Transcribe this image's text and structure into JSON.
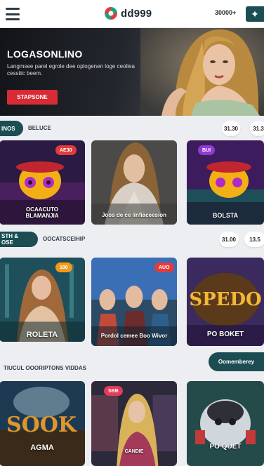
{
  "header": {
    "brand": "dd999",
    "balance": "30000+",
    "action_icon": "plus-sparkle-icon"
  },
  "hero": {
    "title": "LOGASONLINO",
    "subtitle": "Langmsee parel egrole dee oplogenen loge ceoliea cessiiic beem.",
    "cta": "STAPSONE"
  },
  "rows": [
    {
      "pill": "INOS",
      "label": "BELUCE",
      "chips": [
        "31.30",
        "31.3"
      ]
    },
    {
      "pill": "STH & OSE",
      "label": "OOCATSCEIHIP",
      "chips": [
        "31.00",
        "13.5"
      ]
    }
  ],
  "games_row1": [
    {
      "badge": "AE30",
      "title": "OCAACUTO\nBLAMANJIA"
    },
    {
      "badge": "",
      "title": "Joos de ce linfiaceesion"
    },
    {
      "badge": "BUI",
      "title": "BOLSTA"
    }
  ],
  "games_row2": [
    {
      "badge": "100",
      "title": "ROLETA"
    },
    {
      "badge": "AUO",
      "title": "Pordol cemee Boo Wivor"
    },
    {
      "badge": "",
      "title": "PO BOKET"
    }
  ],
  "section": {
    "title": "TIUCUL OOORIPTONS VIDDAS",
    "cta": "Oomemberey"
  },
  "games_row3": [
    {
      "badge": "",
      "title": "AGMA"
    },
    {
      "badge": "SBB",
      "title": "CANDIE"
    },
    {
      "badge": "",
      "title": "PO QUET"
    }
  ],
  "colors": {
    "accent": "#1b4d52",
    "cta_red": "#d72b35",
    "page_bg": "#eceef1"
  }
}
